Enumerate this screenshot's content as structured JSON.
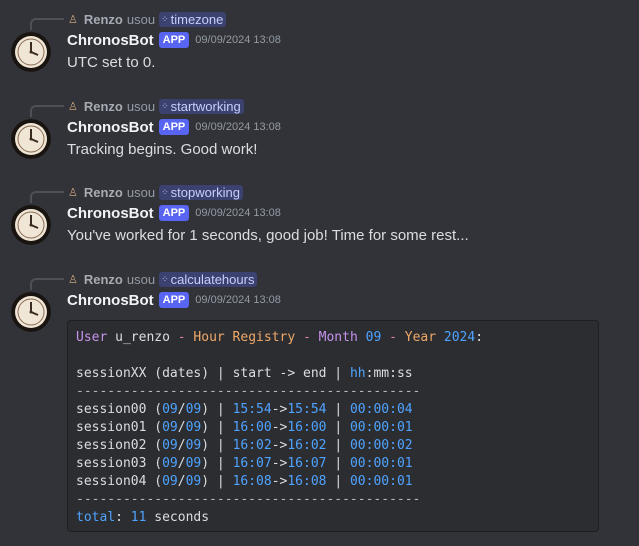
{
  "messages": [
    {
      "reply": {
        "user": "Renzo",
        "verb": "usou",
        "command": "timezone"
      },
      "author": "ChronosBot",
      "badge": "APP",
      "timestamp": "09/09/2024 13:08",
      "text": "UTC set to 0."
    },
    {
      "reply": {
        "user": "Renzo",
        "verb": "usou",
        "command": "startworking"
      },
      "author": "ChronosBot",
      "badge": "APP",
      "timestamp": "09/09/2024 13:08",
      "text": "Tracking begins. Good work!"
    },
    {
      "reply": {
        "user": "Renzo",
        "verb": "usou",
        "command": "stopworking"
      },
      "author": "ChronosBot",
      "badge": "APP",
      "timestamp": "09/09/2024 13:08",
      "text": "You've worked for 1 seconds, good job! Time for some rest..."
    },
    {
      "reply": {
        "user": "Renzo",
        "verb": "usou",
        "command": "calculatehours"
      },
      "author": "ChronosBot",
      "badge": "APP",
      "timestamp": "09/09/2024 13:08",
      "text": ""
    }
  ],
  "code": {
    "header": {
      "user_kw": "User",
      "username": "u_renzo",
      "dash1": "-",
      "title": "Hour Registry",
      "dash2": "-",
      "month_kw": "Month",
      "month": "09",
      "dash3": "-",
      "year_kw": "Year",
      "year": "2024",
      "colon": ":"
    },
    "columns": {
      "session": "sessionXX",
      "dates": "(dates)",
      "range": "start -> end",
      "hh": "hh",
      "mm": "mm",
      "ss": "ss"
    },
    "separator": "--------------------------------------------",
    "rows": [
      {
        "session": "session00",
        "day": "09",
        "month": "09",
        "start": "15:54",
        "end": "15:54",
        "duration": "00:00:04"
      },
      {
        "session": "session01",
        "day": "09",
        "month": "09",
        "start": "16:00",
        "end": "16:00",
        "duration": "00:00:01"
      },
      {
        "session": "session02",
        "day": "09",
        "month": "09",
        "start": "16:02",
        "end": "16:02",
        "duration": "00:00:02"
      },
      {
        "session": "session03",
        "day": "09",
        "month": "09",
        "start": "16:07",
        "end": "16:07",
        "duration": "00:00:01"
      },
      {
        "session": "session04",
        "day": "09",
        "month": "09",
        "start": "16:08",
        "end": "16:08",
        "duration": "00:00:01"
      }
    ],
    "total": {
      "label": "total",
      "value": "11",
      "unit": "seconds"
    }
  },
  "icons": {
    "avatar": "clock-avatar-icon",
    "command": "slash-command-icon",
    "mini_avatar": "user-mini-avatar-icon"
  },
  "colors": {
    "background": "#323339",
    "app_badge": "#5865f2",
    "command_bg": "#3c4270"
  }
}
